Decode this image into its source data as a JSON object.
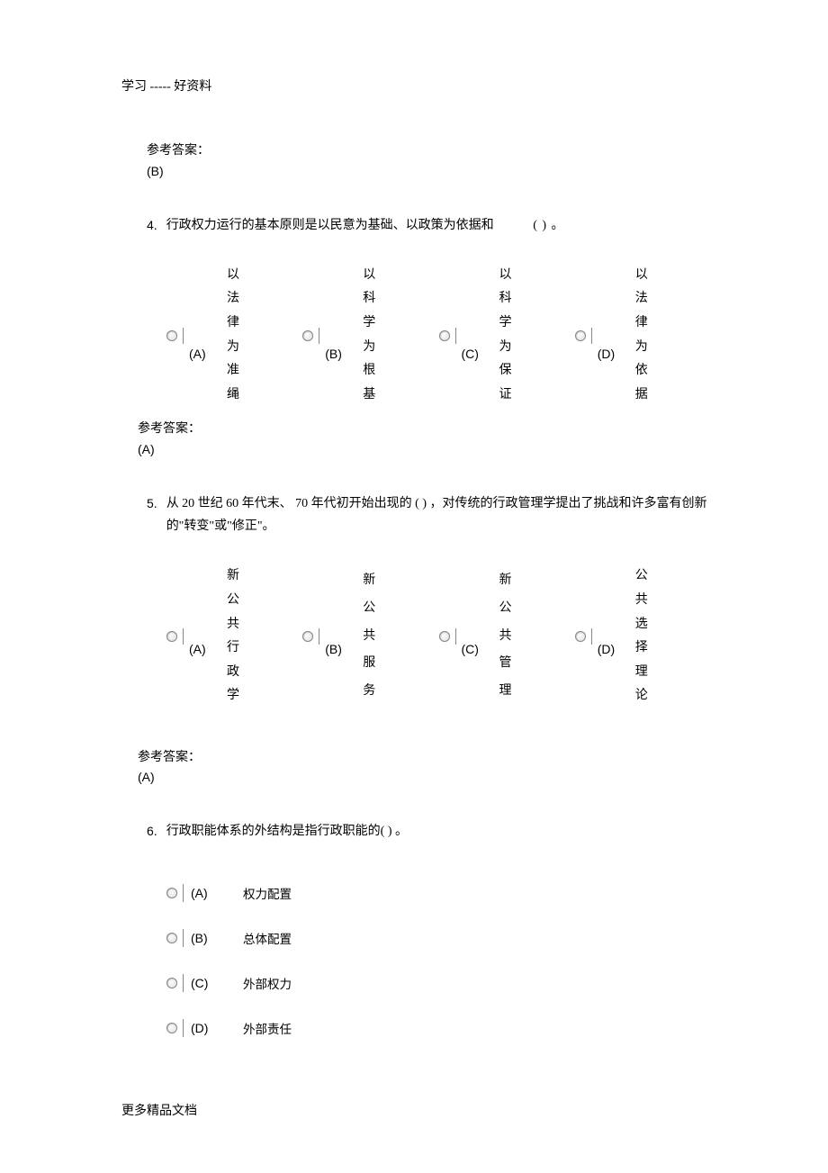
{
  "header": "学习 ----- 好资料",
  "footer": "更多精品文档",
  "answer_label": "参考答案：",
  "prev_answer": "(B)",
  "q4": {
    "num": "4.",
    "text_a": "行政权力运行的基本原则是以民意为基础、以政策为依据和",
    "text_b": "( ) 。",
    "options": {
      "A": [
        "以",
        "法",
        "律",
        "为",
        "准",
        "绳"
      ],
      "B": [
        "以",
        "科",
        "学",
        "为",
        "根",
        "基"
      ],
      "C": [
        "以",
        "科",
        "学",
        "为",
        "保",
        "证"
      ],
      "D": [
        "以",
        "法",
        "律",
        "为",
        "依",
        "据"
      ]
    },
    "letters": {
      "A": "(A)",
      "B": "(B)",
      "C": "(C)",
      "D": "(D)"
    },
    "answer": "(A)"
  },
  "q5": {
    "num": "5.",
    "text": "从 20 世纪 60 年代末、 70 年代初开始出现的 ( ) ，对传统的行政管理学提出了挑战和许多富有创新的\"转变\"或\"修正\"。",
    "options": {
      "A": [
        "新",
        "公",
        "共",
        "行",
        "政",
        "学"
      ],
      "B": [
        "新",
        "公",
        "共",
        "服",
        "务"
      ],
      "C": [
        "新",
        "公",
        "共",
        "管",
        "理"
      ],
      "D": [
        "公",
        "共",
        "选",
        "择",
        "理",
        "论"
      ]
    },
    "letters": {
      "A": "(A)",
      "B": "(B)",
      "C": "(C)",
      "D": "(D)"
    },
    "answer": "(A)"
  },
  "q6": {
    "num": "6.",
    "text": "行政职能体系的外结构是指行政职能的( ) 。",
    "options": {
      "A": "权力配置",
      "B": "总体配置",
      "C": "外部权力",
      "D": "外部责任"
    },
    "letters": {
      "A": "(A)",
      "B": "(B)",
      "C": "(C)",
      "D": "(D)"
    }
  }
}
